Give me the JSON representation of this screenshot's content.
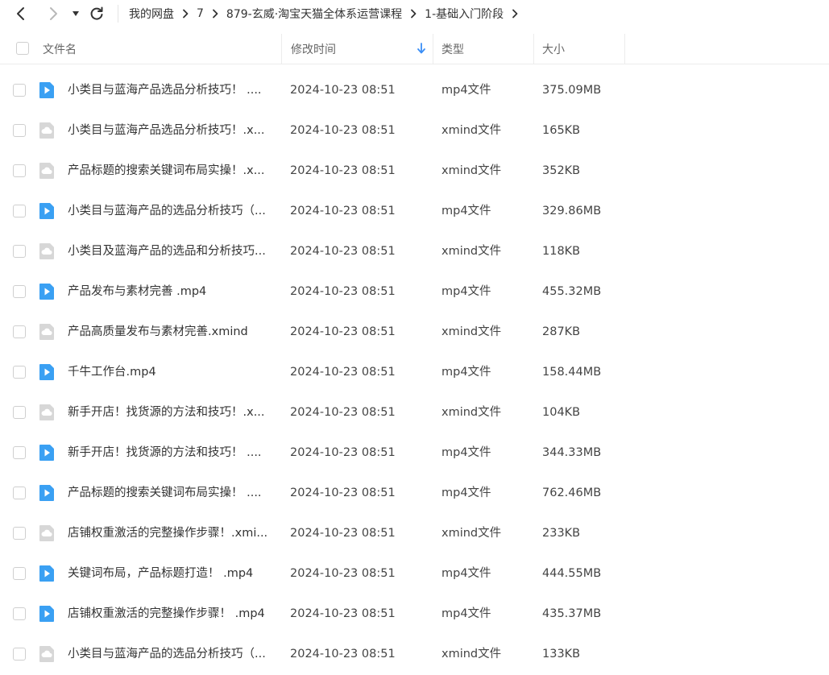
{
  "breadcrumbs": [
    "我的网盘",
    "7",
    "879-玄威·淘宝天猫全体系运营课程",
    "1-基础入门阶段"
  ],
  "columns": {
    "name": "文件名",
    "modified": "修改时间",
    "type": "类型",
    "size": "大小"
  },
  "colors": {
    "video_icon": "#3aa0f3",
    "cloud_icon": "#d7d7d7"
  },
  "files": [
    {
      "name": "小类目与蓝海产品选品分析技巧！ ....",
      "modified": "2024-10-23 08:51",
      "type": "mp4文件",
      "size": "375.09MB",
      "icon": "video-file-icon"
    },
    {
      "name": "小类目与蓝海产品选品分析技巧！.x...",
      "modified": "2024-10-23 08:51",
      "type": "xmind文件",
      "size": "165KB",
      "icon": "cloud-file-icon"
    },
    {
      "name": "产品标题的搜索关键词布局实操！.x...",
      "modified": "2024-10-23 08:51",
      "type": "xmind文件",
      "size": "352KB",
      "icon": "cloud-file-icon"
    },
    {
      "name": "小类目与蓝海产品的选品分析技巧（...",
      "modified": "2024-10-23 08:51",
      "type": "mp4文件",
      "size": "329.86MB",
      "icon": "video-file-icon"
    },
    {
      "name": "小类目及蓝海产品的选品和分析技巧...",
      "modified": "2024-10-23 08:51",
      "type": "xmind文件",
      "size": "118KB",
      "icon": "cloud-file-icon"
    },
    {
      "name": "产品发布与素材完善 .mp4",
      "modified": "2024-10-23 08:51",
      "type": "mp4文件",
      "size": "455.32MB",
      "icon": "video-file-icon"
    },
    {
      "name": "产品高质量发布与素材完善.xmind",
      "modified": "2024-10-23 08:51",
      "type": "xmind文件",
      "size": "287KB",
      "icon": "cloud-file-icon"
    },
    {
      "name": "千牛工作台.mp4",
      "modified": "2024-10-23 08:51",
      "type": "mp4文件",
      "size": "158.44MB",
      "icon": "video-file-icon"
    },
    {
      "name": "新手开店！找货源的方法和技巧！.x...",
      "modified": "2024-10-23 08:51",
      "type": "xmind文件",
      "size": "104KB",
      "icon": "cloud-file-icon"
    },
    {
      "name": "新手开店！找货源的方法和技巧！ ....",
      "modified": "2024-10-23 08:51",
      "type": "mp4文件",
      "size": "344.33MB",
      "icon": "video-file-icon"
    },
    {
      "name": "产品标题的搜索关键词布局实操！ ....",
      "modified": "2024-10-23 08:51",
      "type": "mp4文件",
      "size": "762.46MB",
      "icon": "video-file-icon"
    },
    {
      "name": "店铺权重激活的完整操作步骤！.xmi...",
      "modified": "2024-10-23 08:51",
      "type": "xmind文件",
      "size": "233KB",
      "icon": "cloud-file-icon"
    },
    {
      "name": "关键词布局，产品标题打造！ .mp4",
      "modified": "2024-10-23 08:51",
      "type": "mp4文件",
      "size": "444.55MB",
      "icon": "video-file-icon"
    },
    {
      "name": "店铺权重激活的完整操作步骤！ .mp4",
      "modified": "2024-10-23 08:51",
      "type": "mp4文件",
      "size": "435.37MB",
      "icon": "video-file-icon"
    },
    {
      "name": "小类目与蓝海产品的选品分析技巧（...",
      "modified": "2024-10-23 08:51",
      "type": "xmind文件",
      "size": "133KB",
      "icon": "cloud-file-icon"
    }
  ]
}
